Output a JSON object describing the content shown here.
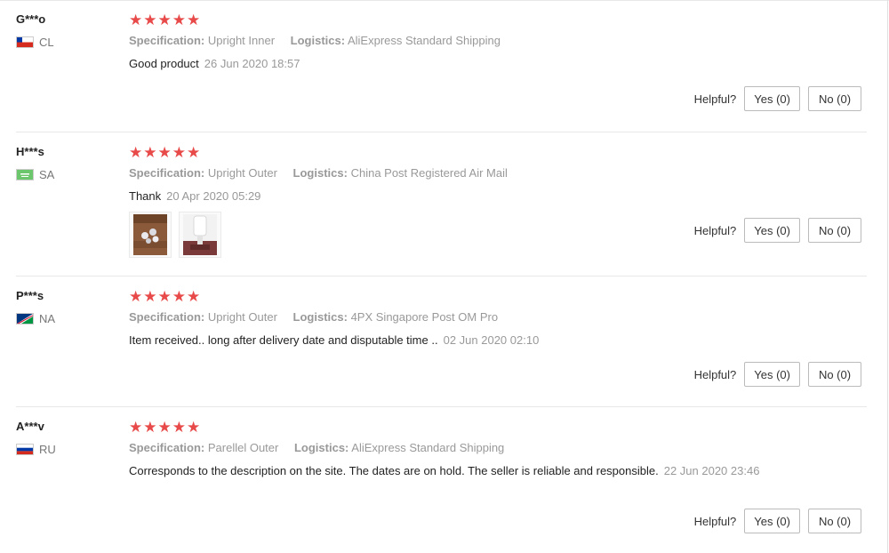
{
  "reviews": [
    {
      "user": "G***o",
      "country": "CL",
      "spec_label": "Specification:",
      "spec_value": "Upright Inner",
      "logistics_label": "Logistics:",
      "logistics_value": "AliExpress Standard Shipping",
      "text": "Good product",
      "date": "26 Jun 2020 18:57",
      "helpful_label": "Helpful?",
      "yes_label": "Yes (0)",
      "no_label": "No (0)",
      "rating": "5 of 5",
      "photos": []
    },
    {
      "user": "H***s",
      "country": "SA",
      "spec_label": "Specification:",
      "spec_value": "Upright Outer",
      "logistics_label": "Logistics:",
      "logistics_value": "China Post Registered Air Mail",
      "text": "Thank",
      "date": "20 Apr 2020 05:29",
      "helpful_label": "Helpful?",
      "yes_label": "Yes (0)",
      "no_label": "No (0)",
      "rating": "5 of 5",
      "photos": [
        "photo-parts",
        "photo-spray-gun"
      ]
    },
    {
      "user": "P***s",
      "country": "NA",
      "spec_label": "Specification:",
      "spec_value": "Upright Outer",
      "logistics_label": "Logistics:",
      "logistics_value": "4PX Singapore Post OM Pro",
      "text": "Item received.. long after delivery date and disputable time ..",
      "date": "02 Jun 2020 02:10",
      "helpful_label": "Helpful?",
      "yes_label": "Yes (0)",
      "no_label": "No (0)",
      "rating": "5 of 5",
      "photos": []
    },
    {
      "user": "A***v",
      "country": "RU",
      "spec_label": "Specification:",
      "spec_value": "Parellel Outer",
      "logistics_label": "Logistics:",
      "logistics_value": "AliExpress Standard Shipping",
      "text": "Corresponds to the description on the site. The dates are on hold. The seller is reliable and responsible.",
      "date": "22 Jun 2020 23:46",
      "helpful_label": "Helpful?",
      "yes_label": "Yes (0)",
      "no_label": "No (0)",
      "rating": "5 of 5",
      "photos": []
    }
  ],
  "colors": {
    "star": "#e84a4a",
    "meta_text": "#999999",
    "separator": "#e8e8e8"
  }
}
